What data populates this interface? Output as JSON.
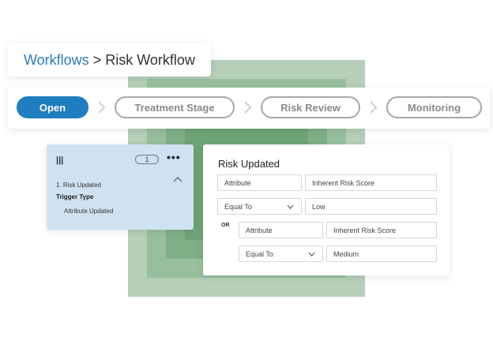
{
  "breadcrumb": {
    "link": "Workflows",
    "separator": ">",
    "current": "Risk Workflow"
  },
  "stages": [
    {
      "label": "Open",
      "state": "active"
    },
    {
      "label": "Treatment Stage",
      "state": "inactive"
    },
    {
      "label": "Risk Review",
      "state": "inactive"
    },
    {
      "label": "Monitoring",
      "state": "inactive"
    }
  ],
  "trigger_card": {
    "handle_icon": "drag-handle-icon",
    "count": "1",
    "menu_icon": "more-options-icon",
    "collapse_icon": "chevron-up-icon",
    "item_title": "1. Risk Updated",
    "trigger_type_label": "Trigger Type",
    "trigger_type_value": "Attribute Updated"
  },
  "conditions": {
    "title": "Risk Updated",
    "row1": {
      "field": "Attribute",
      "value": "Inherent Risk Score"
    },
    "row2": {
      "operator": "Equal To",
      "value": "Low"
    },
    "or_label": "OR",
    "row3": {
      "field": "Attribute",
      "value": "Inherent Risk Score"
    },
    "row4": {
      "operator": "Equal To",
      "value": "Medium"
    }
  },
  "colors": {
    "accent": "#1f7ec1",
    "link": "#2a7ab8",
    "card_blue": "#cfe2f1",
    "inactive_border": "#a7a7a7"
  }
}
